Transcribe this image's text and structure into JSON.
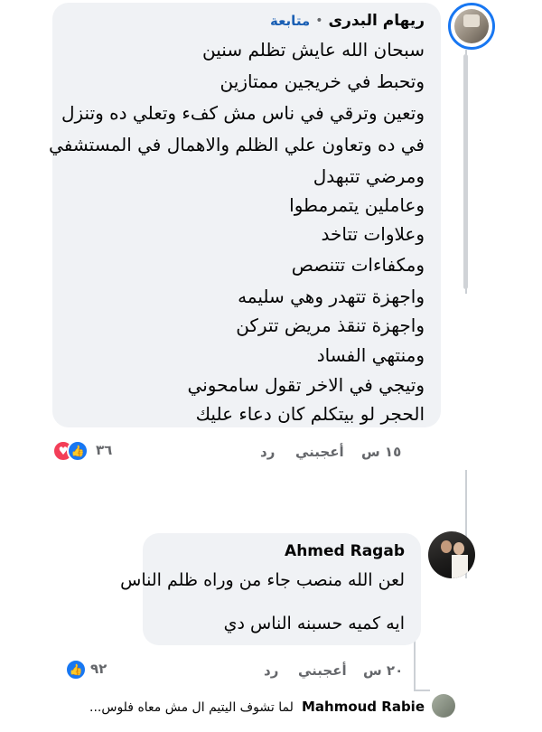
{
  "comments": [
    {
      "author": "ريهام البدرى",
      "follow": "متابعة",
      "lines": [
        "سبحان الله عايش تظلم سنين",
        "وتحبط في خريجين ممتازين",
        "وتعين وترقي في ناس مش كفء وتعلي ده وتنزل",
        "في ده وتعاون علي الظلم والاهمال في المستشفي",
        "ومرضي تتبهدل",
        "وعاملين يتمرمطوا",
        "وعلاوات تتاخد",
        "ومكفاءات تتنصص",
        "واجهزة تتهدر وهي سليمه",
        "واجهزة تنقذ مريض تتركن",
        "ومنتهي الفساد",
        "وتيجي في الاخر تقول سامحوني",
        "الحجر لو بيتكلم كان دعاء عليك"
      ],
      "time": "١٥ س",
      "like": "أعجبني",
      "reply": "رد",
      "reaction_count": "٣٦"
    },
    {
      "author": "Ahmed Ragab",
      "lines": [
        "لعن الله منصب جاء من وراه ظلم الناس",
        "",
        "ايه كميه حسبنه الناس دي"
      ],
      "time": "٢٠ س",
      "like": "أعجبني",
      "reply": "رد",
      "reaction_count": "٩٢"
    }
  ],
  "reply_preview": {
    "author": "Mahmoud Rabie",
    "text": "لما تشوف اليتيم ال مش معاه فلوس..."
  },
  "reactions": {
    "like_icon": "like-icon",
    "love_icon": "heart-icon",
    "like_color": "#1877f2",
    "love_color": "#f33e58"
  }
}
